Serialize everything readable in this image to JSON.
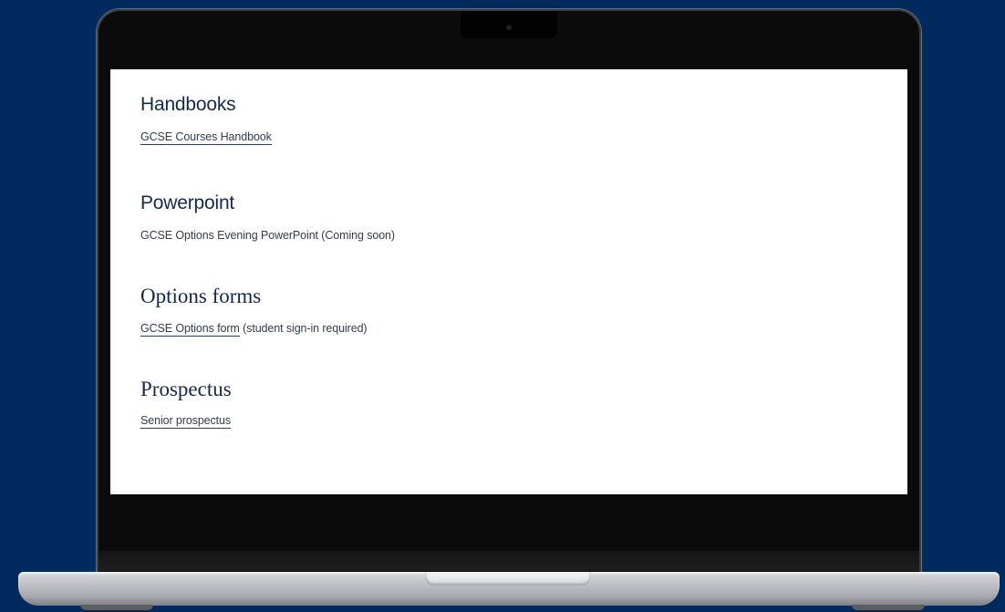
{
  "sections": {
    "handbooks": {
      "heading": "Handbooks",
      "link_label": "GCSE Courses Handbook"
    },
    "powerpoint": {
      "heading": "Powerpoint",
      "text": "GCSE Options Evening PowerPoint (Coming soon)"
    },
    "options_forms": {
      "heading": "Options forms",
      "link_label": "GCSE Options form",
      "suffix": " (student sign-in required)"
    },
    "prospectus": {
      "heading": "Prospectus",
      "link_label": "Senior prospectus"
    }
  },
  "colors": {
    "background": "#032a5e",
    "heading": "#14284d",
    "text": "#2f3d55",
    "screen": "#ffffff"
  }
}
